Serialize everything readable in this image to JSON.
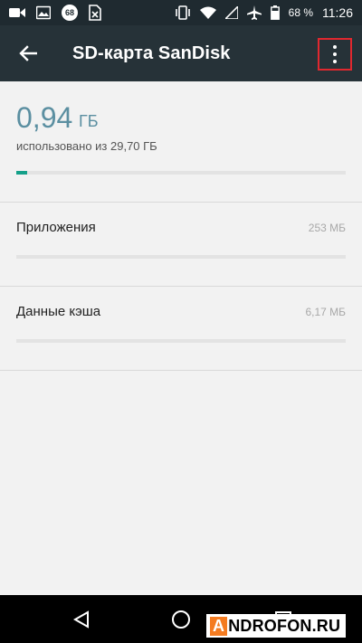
{
  "status_bar": {
    "left_icons": [
      "video-icon",
      "image-icon",
      "badge-68",
      "sim-icon"
    ],
    "badge_text": "68",
    "battery_percent": "68 %",
    "time": "11:26"
  },
  "app_bar": {
    "title": "SD-карта SanDisk"
  },
  "storage": {
    "used_value": "0,94",
    "used_unit": "ГБ",
    "caption": "использовано из 29,70 ГБ",
    "used_fraction": 0.032,
    "accent_color": "#14a089"
  },
  "items": [
    {
      "label": "Приложения",
      "size": "253 МБ",
      "fraction": 0.0
    },
    {
      "label": "Данные кэша",
      "size": "6,17 МБ",
      "fraction": 0.0
    }
  ],
  "watermark": {
    "prefix": "A",
    "text": "NDROFON.RU"
  }
}
